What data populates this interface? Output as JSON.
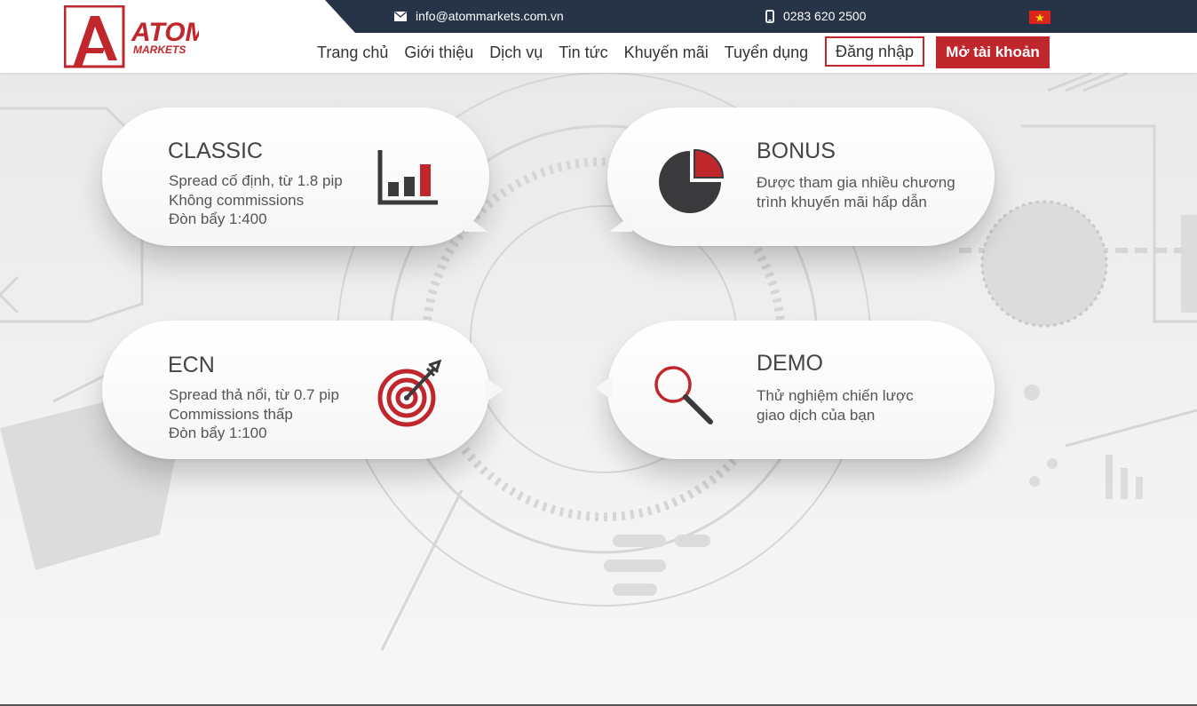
{
  "header": {
    "logo_text": "ATOM",
    "logo_subtext": "MARKETS",
    "email": "info@atommarkets.com.vn",
    "phone": "0283 620 2500",
    "nav": [
      "Trang chủ",
      "Giới thiệu",
      "Dịch vụ",
      "Tin tức",
      "Khuyến mãi",
      "Tuyển dụng"
    ],
    "login_label": "Đăng nhập",
    "open_account_label": "Mở tài khoản",
    "language_icon": "vietnam-flag-icon"
  },
  "cards": [
    {
      "title": "CLASSIC",
      "lines": [
        "Spread cố định, từ 1.8 pip",
        "Không commissions",
        "Đòn bẩy 1:400"
      ],
      "icon": "bar-chart-icon"
    },
    {
      "title": "BONUS",
      "lines": [
        "Được tham gia nhiều chương",
        "trình khuyến mãi hấp dẫn"
      ],
      "icon": "pie-chart-icon"
    },
    {
      "title": "ECN",
      "lines": [
        "Spread thả nổi, từ 0.7 pip",
        "Commissions thấp",
        "Đòn bẩy 1:100"
      ],
      "icon": "target-icon"
    },
    {
      "title": "DEMO",
      "lines": [
        "Thử nghiệm chiến lược",
        "giao dịch của bạn"
      ],
      "icon": "magnifier-icon"
    }
  ],
  "colors": {
    "brand_red": "#c0272d",
    "topbar_navy": "#273448",
    "text_dark": "#444444"
  }
}
